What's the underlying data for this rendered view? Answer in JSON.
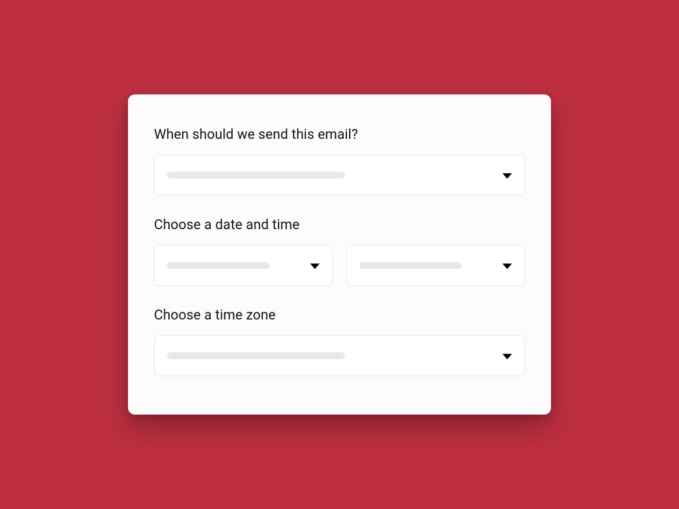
{
  "form": {
    "send_when": {
      "label": "When should we send this email?"
    },
    "date_time": {
      "label": "Choose a date and time"
    },
    "timezone": {
      "label": "Choose a time zone"
    }
  }
}
